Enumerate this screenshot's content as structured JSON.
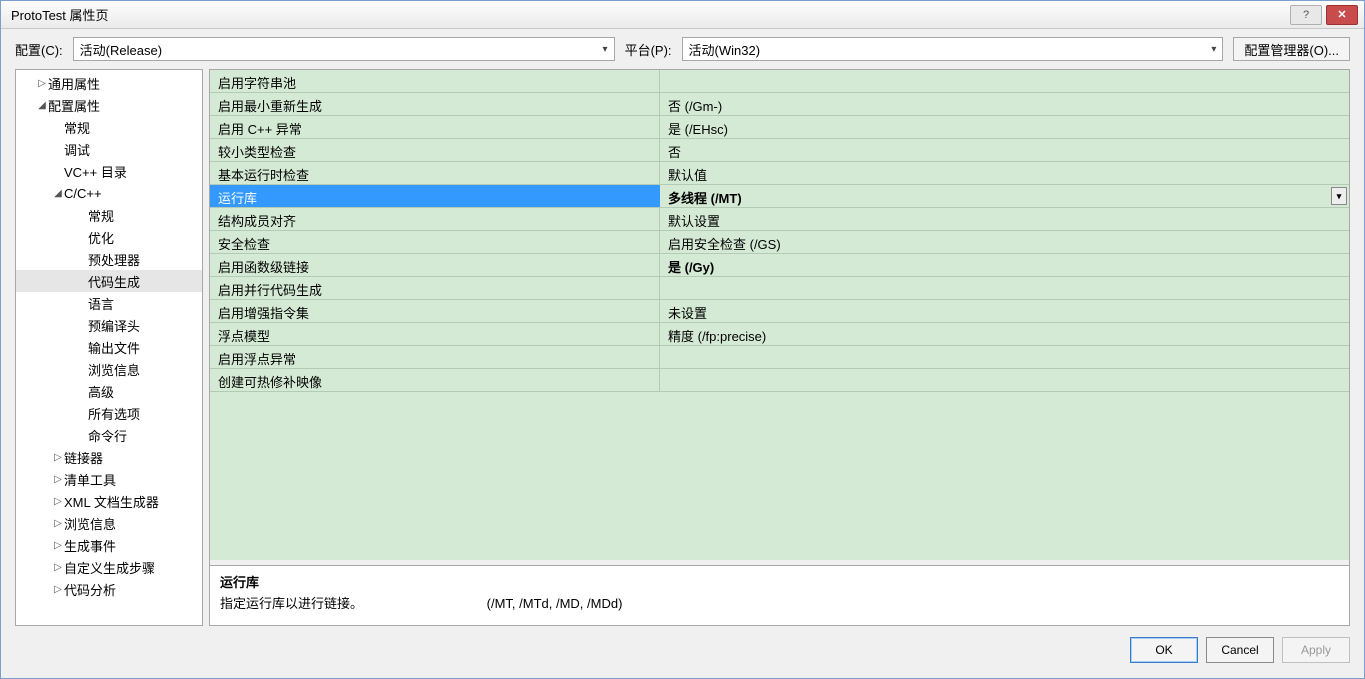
{
  "window": {
    "title": "ProtoTest 属性页"
  },
  "toolbar": {
    "config_label": "配置(C):",
    "config_value": "活动(Release)",
    "platform_label": "平台(P):",
    "platform_value": "活动(Win32)",
    "config_manager": "配置管理器(O)..."
  },
  "tree": [
    {
      "level": 1,
      "caret": "▷",
      "label": "通用属性"
    },
    {
      "level": 1,
      "caret": "◢",
      "label": "配置属性"
    },
    {
      "level": 2,
      "caret": "",
      "label": "常规"
    },
    {
      "level": 2,
      "caret": "",
      "label": "调试"
    },
    {
      "level": 2,
      "caret": "",
      "label": "VC++ 目录"
    },
    {
      "level": 2,
      "caret": "◢",
      "label": "C/C++"
    },
    {
      "level": 3,
      "caret": "",
      "label": "常规"
    },
    {
      "level": 3,
      "caret": "",
      "label": "优化"
    },
    {
      "level": 3,
      "caret": "",
      "label": "预处理器"
    },
    {
      "level": 3,
      "caret": "",
      "label": "代码生成",
      "selected": true
    },
    {
      "level": 3,
      "caret": "",
      "label": "语言"
    },
    {
      "level": 3,
      "caret": "",
      "label": "预编译头"
    },
    {
      "level": 3,
      "caret": "",
      "label": "输出文件"
    },
    {
      "level": 3,
      "caret": "",
      "label": "浏览信息"
    },
    {
      "level": 3,
      "caret": "",
      "label": "高级"
    },
    {
      "level": 3,
      "caret": "",
      "label": "所有选项"
    },
    {
      "level": 3,
      "caret": "",
      "label": "命令行"
    },
    {
      "level": 2,
      "caret": "▷",
      "label": "链接器"
    },
    {
      "level": 2,
      "caret": "▷",
      "label": "清单工具"
    },
    {
      "level": 2,
      "caret": "▷",
      "label": "XML 文档生成器"
    },
    {
      "level": 2,
      "caret": "▷",
      "label": "浏览信息"
    },
    {
      "level": 2,
      "caret": "▷",
      "label": "生成事件"
    },
    {
      "level": 2,
      "caret": "▷",
      "label": "自定义生成步骤"
    },
    {
      "level": 2,
      "caret": "▷",
      "label": "代码分析"
    }
  ],
  "grid": [
    {
      "prop": "启用字符串池",
      "val": ""
    },
    {
      "prop": "启用最小重新生成",
      "val": "否 (/Gm-)"
    },
    {
      "prop": "启用 C++ 异常",
      "val": "是 (/EHsc)"
    },
    {
      "prop": "较小类型检查",
      "val": "否"
    },
    {
      "prop": "基本运行时检查",
      "val": "默认值"
    },
    {
      "prop": "运行库",
      "val": "多线程 (/MT)",
      "selected": true,
      "bold": true,
      "dropdown": true
    },
    {
      "prop": "结构成员对齐",
      "val": "默认设置"
    },
    {
      "prop": "安全检查",
      "val": "启用安全检查 (/GS)"
    },
    {
      "prop": "启用函数级链接",
      "val": "是 (/Gy)",
      "bold": true
    },
    {
      "prop": "启用并行代码生成",
      "val": ""
    },
    {
      "prop": "启用增强指令集",
      "val": "未设置"
    },
    {
      "prop": "浮点模型",
      "val": "精度 (/fp:precise)"
    },
    {
      "prop": "启用浮点异常",
      "val": ""
    },
    {
      "prop": "创建可热修补映像",
      "val": ""
    }
  ],
  "description": {
    "title": "运行库",
    "body": "指定运行库以进行链接。",
    "hint": "(/MT, /MTd, /MD, /MDd)"
  },
  "footer": {
    "ok": "OK",
    "cancel": "Cancel",
    "apply": "Apply"
  }
}
